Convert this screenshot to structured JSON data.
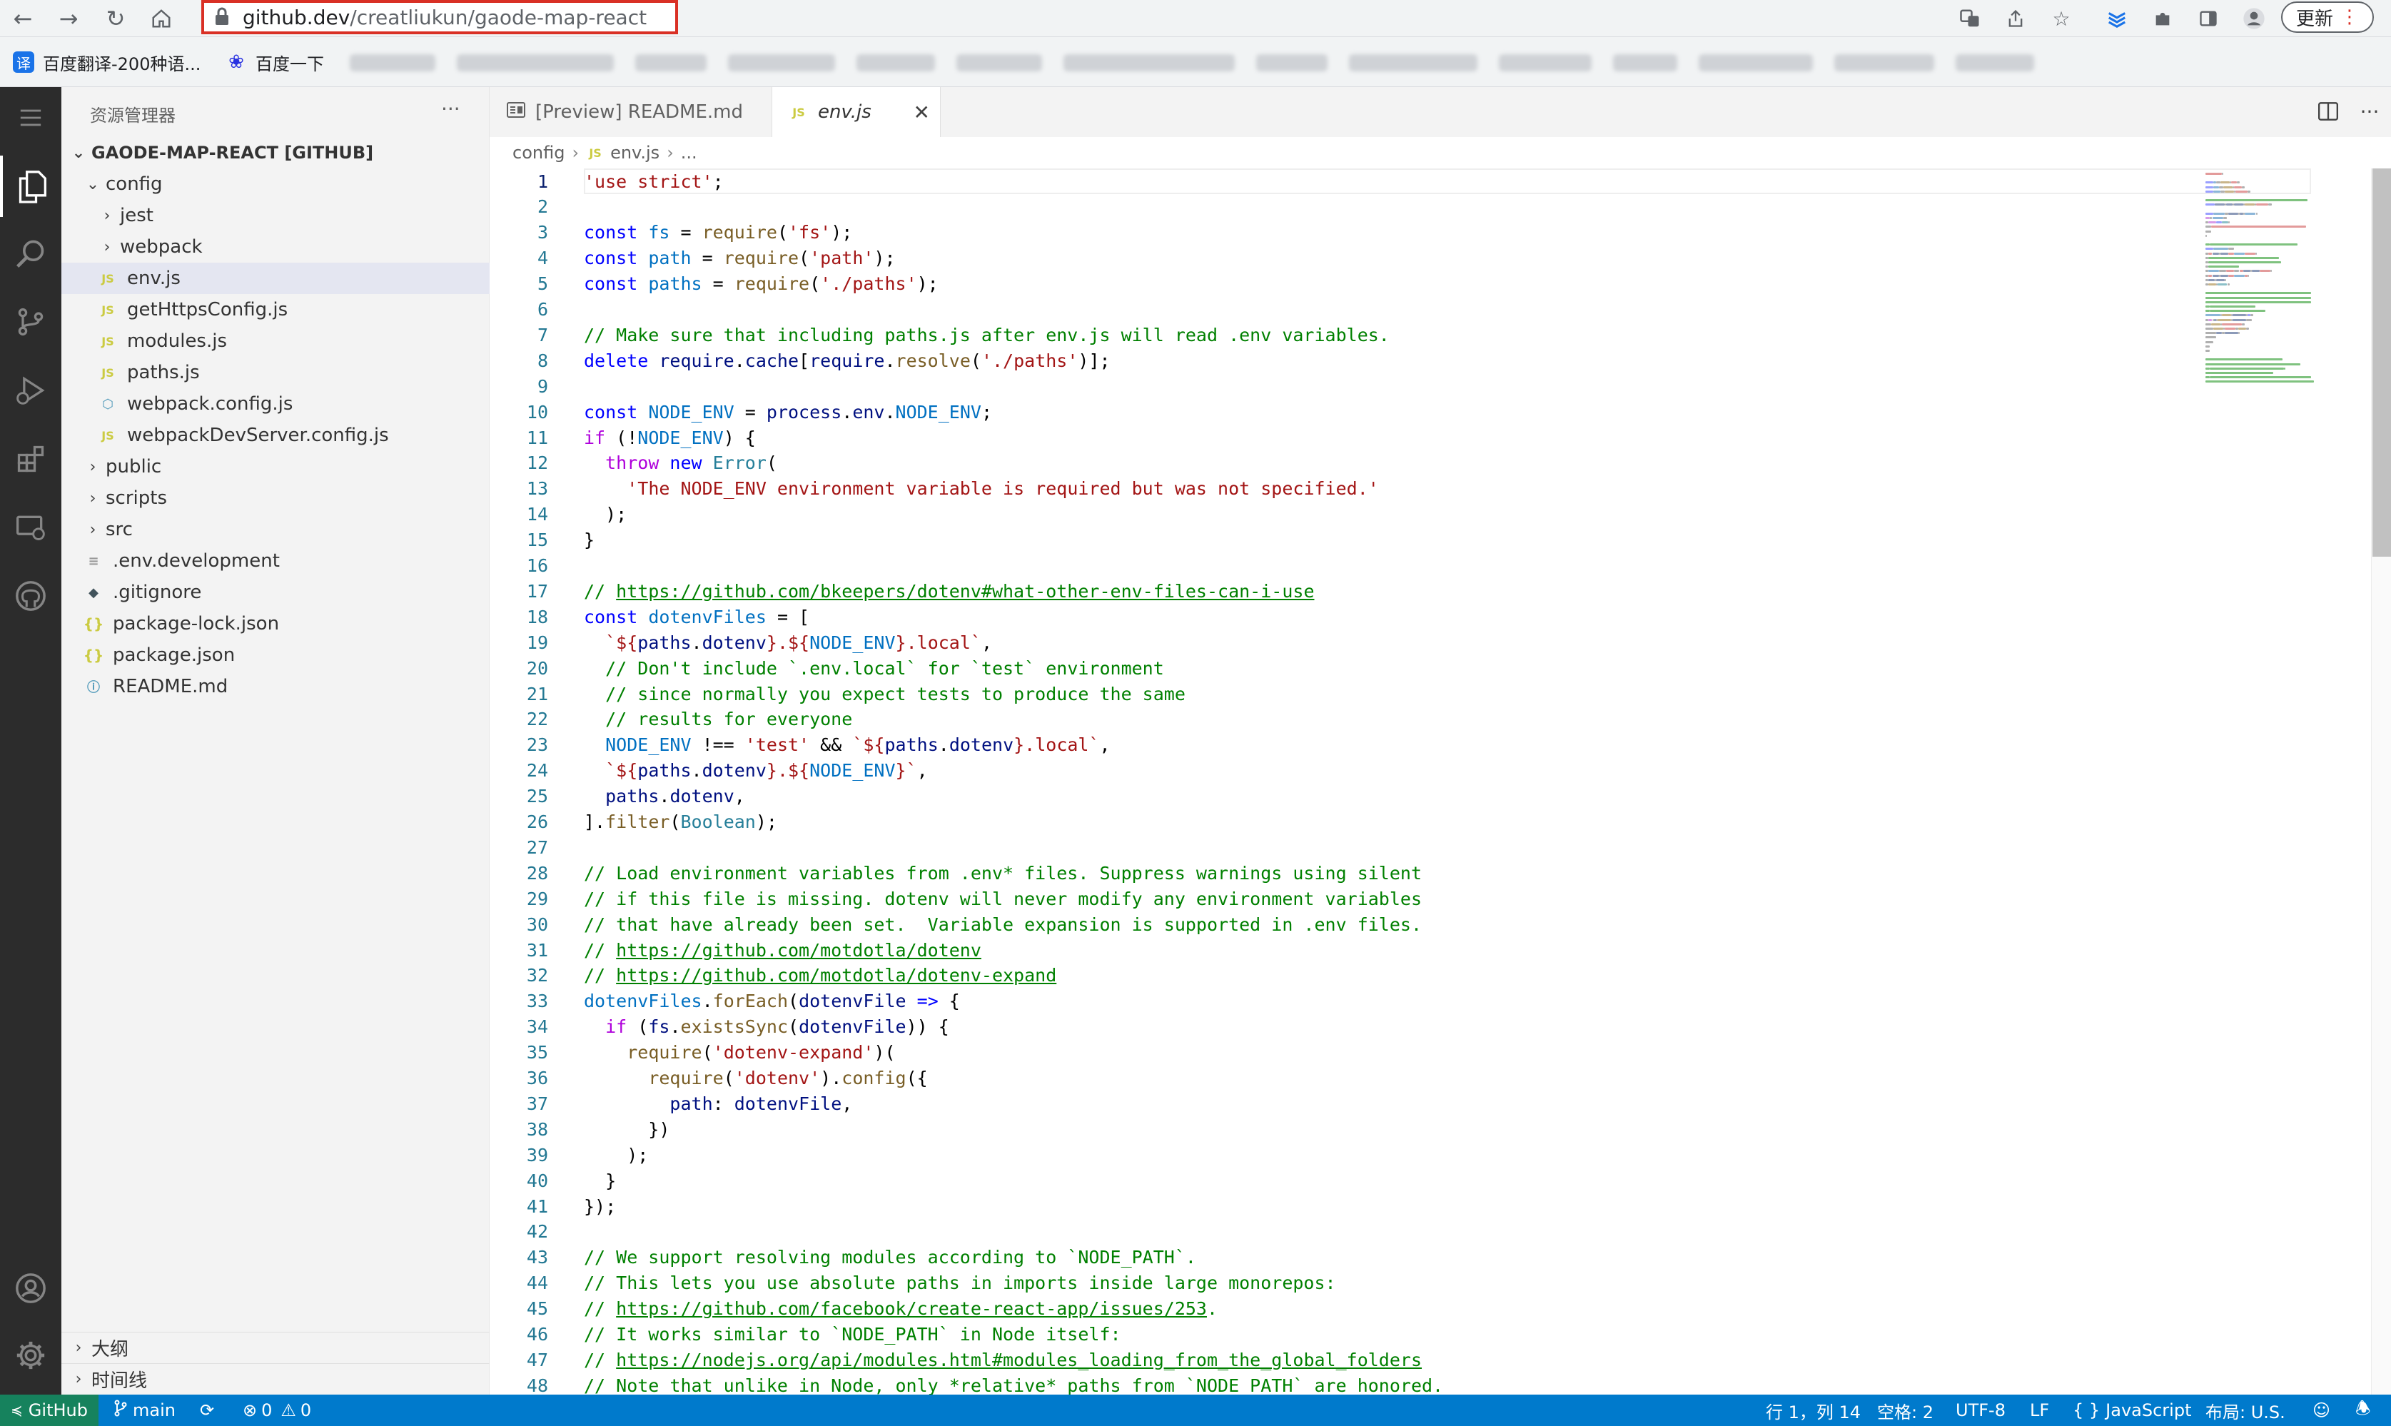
{
  "browser": {
    "url_host": "github.dev",
    "url_path": "/creatliukun/gaode-map-react",
    "update_label": "更新",
    "bookmarks": [
      {
        "label": "百度翻译-200种语...",
        "icon_text": "译",
        "icon_color": "#1a73e8"
      },
      {
        "label": "百度一下",
        "icon_text": "❀",
        "icon_color": "#2932e1"
      }
    ]
  },
  "sidebar": {
    "title": "资源管理器",
    "more": "···",
    "root_label": "GAODE-MAP-REACT [GITHUB]",
    "tree": [
      {
        "label": "config",
        "type": "folder-open"
      },
      {
        "label": "jest",
        "type": "folder"
      },
      {
        "label": "webpack",
        "type": "folder"
      },
      {
        "label": "env.js",
        "type": "js",
        "selected": true
      },
      {
        "label": "getHttpsConfig.js",
        "type": "js"
      },
      {
        "label": "modules.js",
        "type": "js"
      },
      {
        "label": "paths.js",
        "type": "js"
      },
      {
        "label": "webpack.config.js",
        "type": "gear"
      },
      {
        "label": "webpackDevServer.config.js",
        "type": "js"
      },
      {
        "label": "public",
        "type": "folder"
      },
      {
        "label": "scripts",
        "type": "folder"
      },
      {
        "label": "src",
        "type": "folder"
      },
      {
        "label": ".env.development",
        "type": "lines"
      },
      {
        "label": ".gitignore",
        "type": "git"
      },
      {
        "label": "package-lock.json",
        "type": "json"
      },
      {
        "label": "package.json",
        "type": "json"
      },
      {
        "label": "README.md",
        "type": "info"
      }
    ],
    "outline_label": "大纲",
    "timeline_label": "时间线"
  },
  "tabs": [
    {
      "label": "[Preview] README.md",
      "icon": "preview-icon",
      "active": false
    },
    {
      "label": "env.js",
      "icon": "js-file-icon",
      "active": true
    }
  ],
  "breadcrumbs": [
    "config",
    "env.js",
    "..."
  ],
  "editor": {
    "lines": [
      [
        [
          "str",
          "'use strict'"
        ],
        [
          "txt",
          ";"
        ]
      ],
      [],
      [
        [
          "kw",
          "const "
        ],
        [
          "var",
          "fs"
        ],
        [
          "txt",
          " = "
        ],
        [
          "fn",
          "require"
        ],
        [
          "txt",
          "("
        ],
        [
          "str",
          "'fs'"
        ],
        [
          "txt",
          ");"
        ]
      ],
      [
        [
          "kw",
          "const "
        ],
        [
          "var",
          "path"
        ],
        [
          "txt",
          " = "
        ],
        [
          "fn",
          "require"
        ],
        [
          "txt",
          "("
        ],
        [
          "str",
          "'path'"
        ],
        [
          "txt",
          ");"
        ]
      ],
      [
        [
          "kw",
          "const "
        ],
        [
          "var",
          "paths"
        ],
        [
          "txt",
          " = "
        ],
        [
          "fn",
          "require"
        ],
        [
          "txt",
          "("
        ],
        [
          "str",
          "'./paths'"
        ],
        [
          "txt",
          ");"
        ]
      ],
      [],
      [
        [
          "com",
          "// Make sure that including paths.js after env.js will read .env variables."
        ]
      ],
      [
        [
          "kw",
          "delete "
        ],
        [
          "id",
          "require"
        ],
        [
          "txt",
          "."
        ],
        [
          "id",
          "cache"
        ],
        [
          "txt",
          "["
        ],
        [
          "id",
          "require"
        ],
        [
          "txt",
          "."
        ],
        [
          "fn",
          "resolve"
        ],
        [
          "txt",
          "("
        ],
        [
          "str",
          "'./paths'"
        ],
        [
          "txt",
          ")];"
        ]
      ],
      [],
      [
        [
          "kw",
          "const "
        ],
        [
          "var",
          "NODE_ENV"
        ],
        [
          "txt",
          " = "
        ],
        [
          "id",
          "process"
        ],
        [
          "txt",
          "."
        ],
        [
          "id",
          "env"
        ],
        [
          "txt",
          "."
        ],
        [
          "var",
          "NODE_ENV"
        ],
        [
          "txt",
          ";"
        ]
      ],
      [
        [
          "ctl",
          "if "
        ],
        [
          "txt",
          "(!"
        ],
        [
          "var",
          "NODE_ENV"
        ],
        [
          "txt",
          ") {"
        ]
      ],
      [
        [
          "txt",
          "  "
        ],
        [
          "ctl",
          "throw "
        ],
        [
          "kw",
          "new "
        ],
        [
          "type",
          "Error"
        ],
        [
          "txt",
          "("
        ]
      ],
      [
        [
          "txt",
          "    "
        ],
        [
          "str",
          "'The NODE_ENV environment variable is required but was not specified.'"
        ]
      ],
      [
        [
          "txt",
          "  );"
        ]
      ],
      [
        [
          "txt",
          "}"
        ]
      ],
      [],
      [
        [
          "com",
          "// "
        ],
        [
          "link",
          "https://github.com/bkeepers/dotenv#what-other-env-files-can-i-use"
        ]
      ],
      [
        [
          "kw",
          "const "
        ],
        [
          "var",
          "dotenvFiles"
        ],
        [
          "txt",
          " = ["
        ]
      ],
      [
        [
          "txt",
          "  "
        ],
        [
          "str",
          "`${"
        ],
        [
          "id",
          "paths"
        ],
        [
          "txt",
          "."
        ],
        [
          "id",
          "dotenv"
        ],
        [
          "str",
          "}.${"
        ],
        [
          "var",
          "NODE_ENV"
        ],
        [
          "str",
          "}.local`"
        ],
        [
          "txt",
          ","
        ]
      ],
      [
        [
          "txt",
          "  "
        ],
        [
          "com",
          "// Don't include `.env.local` for `test` environment"
        ]
      ],
      [
        [
          "txt",
          "  "
        ],
        [
          "com",
          "// since normally you expect tests to produce the same"
        ]
      ],
      [
        [
          "txt",
          "  "
        ],
        [
          "com",
          "// results for everyone"
        ]
      ],
      [
        [
          "txt",
          "  "
        ],
        [
          "var",
          "NODE_ENV"
        ],
        [
          "txt",
          " !== "
        ],
        [
          "str",
          "'test'"
        ],
        [
          "txt",
          " && "
        ],
        [
          "str",
          "`${"
        ],
        [
          "id",
          "paths"
        ],
        [
          "txt",
          "."
        ],
        [
          "id",
          "dotenv"
        ],
        [
          "str",
          "}.local`"
        ],
        [
          "txt",
          ","
        ]
      ],
      [
        [
          "txt",
          "  "
        ],
        [
          "str",
          "`${"
        ],
        [
          "id",
          "paths"
        ],
        [
          "txt",
          "."
        ],
        [
          "id",
          "dotenv"
        ],
        [
          "str",
          "}.${"
        ],
        [
          "var",
          "NODE_ENV"
        ],
        [
          "str",
          "}`"
        ],
        [
          "txt",
          ","
        ]
      ],
      [
        [
          "txt",
          "  "
        ],
        [
          "id",
          "paths"
        ],
        [
          "txt",
          "."
        ],
        [
          "id",
          "dotenv"
        ],
        [
          "txt",
          ","
        ]
      ],
      [
        [
          "txt",
          "]."
        ],
        [
          "fn",
          "filter"
        ],
        [
          "txt",
          "("
        ],
        [
          "type",
          "Boolean"
        ],
        [
          "txt",
          ");"
        ]
      ],
      [],
      [
        [
          "com",
          "// Load environment variables from .env* files. Suppress warnings using silent"
        ]
      ],
      [
        [
          "com",
          "// if this file is missing. dotenv will never modify any environment variables"
        ]
      ],
      [
        [
          "com",
          "// that have already been set.  Variable expansion is supported in .env files."
        ]
      ],
      [
        [
          "com",
          "// "
        ],
        [
          "link",
          "https://github.com/motdotla/dotenv"
        ]
      ],
      [
        [
          "com",
          "// "
        ],
        [
          "link",
          "https://github.com/motdotla/dotenv-expand"
        ]
      ],
      [
        [
          "var",
          "dotenvFiles"
        ],
        [
          "txt",
          "."
        ],
        [
          "fn",
          "forEach"
        ],
        [
          "txt",
          "("
        ],
        [
          "id",
          "dotenvFile"
        ],
        [
          "txt",
          " "
        ],
        [
          "kw",
          "=>"
        ],
        [
          "txt",
          " {"
        ]
      ],
      [
        [
          "txt",
          "  "
        ],
        [
          "ctl",
          "if "
        ],
        [
          "txt",
          "("
        ],
        [
          "id",
          "fs"
        ],
        [
          "txt",
          "."
        ],
        [
          "fn",
          "existsSync"
        ],
        [
          "txt",
          "("
        ],
        [
          "id",
          "dotenvFile"
        ],
        [
          "txt",
          ")) {"
        ]
      ],
      [
        [
          "txt",
          "    "
        ],
        [
          "fn",
          "require"
        ],
        [
          "txt",
          "("
        ],
        [
          "str",
          "'dotenv-expand'"
        ],
        [
          "txt",
          ")("
        ]
      ],
      [
        [
          "txt",
          "      "
        ],
        [
          "fn",
          "require"
        ],
        [
          "txt",
          "("
        ],
        [
          "str",
          "'dotenv'"
        ],
        [
          "txt",
          ")."
        ],
        [
          "fn",
          "config"
        ],
        [
          "txt",
          "({"
        ]
      ],
      [
        [
          "txt",
          "        "
        ],
        [
          "id",
          "path"
        ],
        [
          "txt",
          ": "
        ],
        [
          "id",
          "dotenvFile"
        ],
        [
          "txt",
          ","
        ]
      ],
      [
        [
          "txt",
          "      })"
        ]
      ],
      [
        [
          "txt",
          "    );"
        ]
      ],
      [
        [
          "txt",
          "  }"
        ]
      ],
      [
        [
          "txt",
          "});"
        ]
      ],
      [],
      [
        [
          "com",
          "// We support resolving modules according to `NODE_PATH`."
        ]
      ],
      [
        [
          "com",
          "// This lets you use absolute paths in imports inside large monorepos:"
        ]
      ],
      [
        [
          "com",
          "// "
        ],
        [
          "link",
          "https://github.com/facebook/create-react-app/issues/253"
        ],
        [
          "com",
          "."
        ]
      ],
      [
        [
          "com",
          "// It works similar to `NODE_PATH` in Node itself:"
        ]
      ],
      [
        [
          "com",
          "// "
        ],
        [
          "link",
          "https://nodejs.org/api/modules.html#modules_loading_from_the_global_folders"
        ]
      ],
      [
        [
          "com",
          "// Note that unlike in Node, only *relative* paths from `NODE_PATH` are honored."
        ]
      ]
    ]
  },
  "statusbar": {
    "remote": "GitHub",
    "branch": "main",
    "errors": "0",
    "warnings": "0",
    "position": "行 1，列 14",
    "spaces": "空格: 2",
    "encoding": "UTF-8",
    "eol": "LF",
    "language": "JavaScript",
    "layout": "布局: U.S."
  }
}
